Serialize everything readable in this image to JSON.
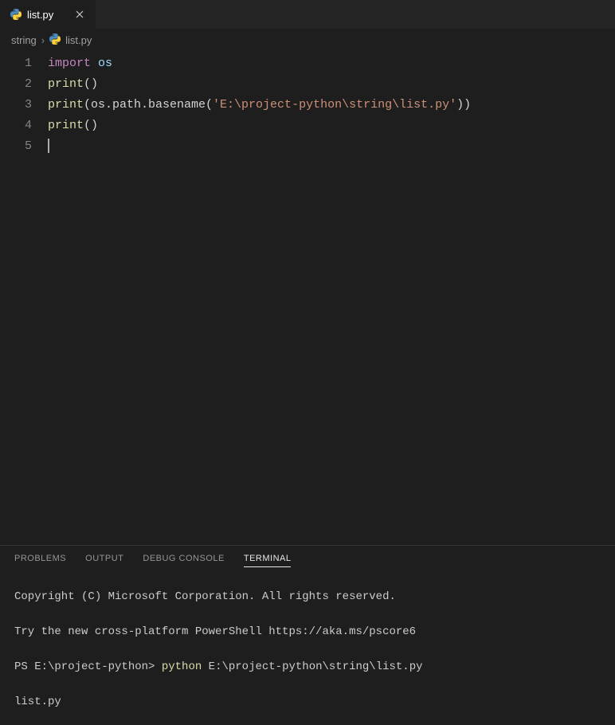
{
  "tab": {
    "filename": "list.py",
    "icon": "python-file-icon"
  },
  "breadcrumb": {
    "parent": "string",
    "file": "list.py"
  },
  "editor": {
    "lines": [
      {
        "num": "1",
        "tokens": [
          {
            "cls": "tk-keyword",
            "text": "import"
          },
          {
            "cls": "tk-plain",
            "text": " "
          },
          {
            "cls": "tk-module",
            "text": "os"
          }
        ]
      },
      {
        "num": "2",
        "tokens": [
          {
            "cls": "tk-builtin",
            "text": "print"
          },
          {
            "cls": "tk-plain",
            "text": "()"
          }
        ]
      },
      {
        "num": "3",
        "tokens": [
          {
            "cls": "tk-builtin",
            "text": "print"
          },
          {
            "cls": "tk-plain",
            "text": "(os.path.basename("
          },
          {
            "cls": "tk-string",
            "text": "'E:\\project-python\\string\\list.py'"
          },
          {
            "cls": "tk-plain",
            "text": "))"
          }
        ]
      },
      {
        "num": "4",
        "tokens": [
          {
            "cls": "tk-builtin",
            "text": "print"
          },
          {
            "cls": "tk-plain",
            "text": "()"
          }
        ]
      },
      {
        "num": "5",
        "tokens": [],
        "cursor": true
      }
    ]
  },
  "panel": {
    "tabs": {
      "problems": "PROBLEMS",
      "output": "OUTPUT",
      "debug": "DEBUG CONSOLE",
      "terminal": "TERMINAL"
    },
    "activeTab": "terminal"
  },
  "terminal": {
    "lines": [
      {
        "segments": [
          {
            "cls": "",
            "text": "Copyright (C) Microsoft Corporation. All rights reserved."
          }
        ]
      },
      {
        "segments": [
          {
            "cls": "",
            "text": ""
          }
        ]
      },
      {
        "segments": [
          {
            "cls": "",
            "text": "Try the new cross-platform PowerShell https://aka.ms/pscore6"
          }
        ]
      },
      {
        "segments": [
          {
            "cls": "",
            "text": ""
          }
        ]
      },
      {
        "segments": [
          {
            "cls": "term-prompt",
            "text": "PS E:\\project-python> "
          },
          {
            "cls": "term-cmd",
            "text": "python"
          },
          {
            "cls": "",
            "text": " E:\\project-python\\string\\list.py"
          }
        ]
      },
      {
        "segments": [
          {
            "cls": "",
            "text": ""
          }
        ]
      },
      {
        "segments": [
          {
            "cls": "",
            "text": "list.py"
          }
        ]
      }
    ]
  }
}
